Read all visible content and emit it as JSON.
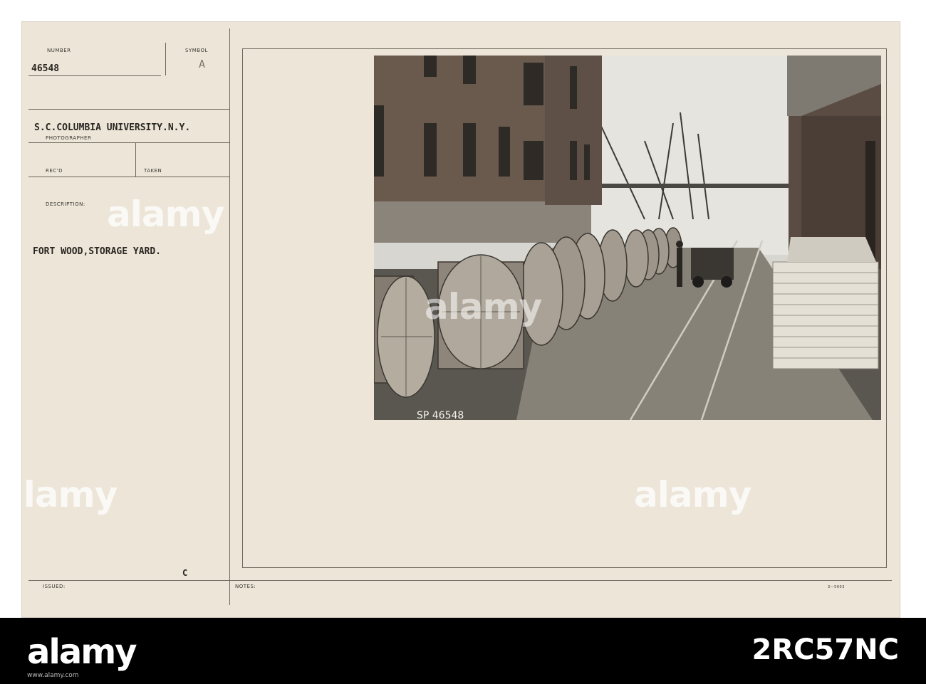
{
  "card": {
    "number_label": "NUMBER",
    "number_value": "46548",
    "symbol_label": "SYMBOL",
    "symbol_value": "A",
    "photographer_value": "S.C.COLUMBIA UNIVERSITY.N.Y.",
    "photographer_label": "PHOTOGRAPHER",
    "recd_label": "REC'D",
    "taken_label": "TAKEN",
    "description_label": "DESCRIPTION:",
    "description_value": "FORT WOOD,STORAGE YARD.",
    "c_mark": "C",
    "issued_label": "ISSUED:",
    "notes_label": "NOTES:",
    "form_code": "3—5603"
  },
  "photo": {
    "negative_number": "SP 46548"
  },
  "watermark": {
    "text": "alamy"
  },
  "footer": {
    "logo": "alamy",
    "image_id": "2RC57NC",
    "caption": "www.alamy.com"
  }
}
